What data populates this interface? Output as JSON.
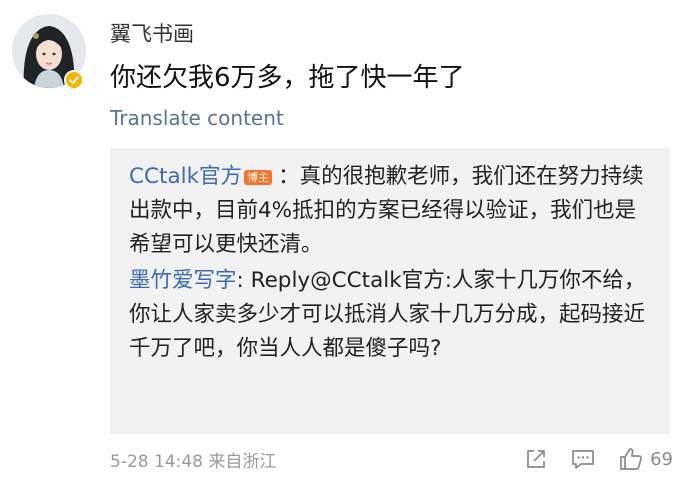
{
  "comment": {
    "author": "翼飞书画",
    "text": "你还欠我6万多，拖了快一年了",
    "translate_label": "Translate content"
  },
  "replies": [
    {
      "name": "CCtalk官方",
      "badge": "博主",
      "separator": "：",
      "text": "真的很抱歉老师，我们还在努力持续出款中，目前4%抵扣的方案已经得以验证，我们也是希望可以更快还清。"
    },
    {
      "name": "墨竹爱写字",
      "separator": ": ",
      "text": "Reply@CCtalk官方:人家十几万你不给，你让人家卖多少才可以抵消人家十几万分成，起码接近千万了吧，你当人人都是傻子吗?"
    }
  ],
  "footer": {
    "timestamp": "5-28 14:48 来自浙江",
    "like_count": "69"
  },
  "icons": {
    "share": "share-icon",
    "reply": "comment-icon",
    "like": "thumbs-up-icon",
    "verified": "verified-badge-icon"
  },
  "colors": {
    "link": "#3e6ab3",
    "translate": "#58729a",
    "badge": "#f5732a",
    "verified": "#f4b400",
    "reply_bg": "#f2f2f2",
    "meta": "#9b9b9b"
  }
}
